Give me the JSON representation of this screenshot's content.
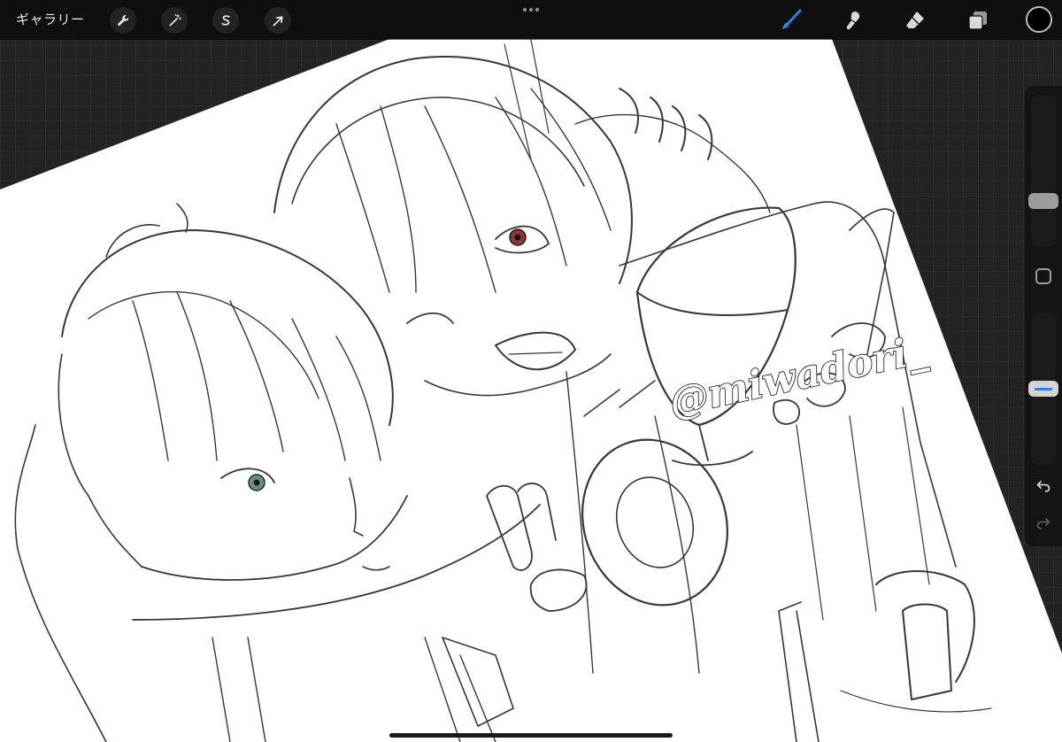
{
  "toolbar": {
    "gallery_label": "ギャラリー",
    "left_actions": [
      {
        "name": "wrench-icon",
        "label": "actions"
      },
      {
        "name": "magic-wand-icon",
        "label": "adjustments"
      },
      {
        "name": "selection-s-icon",
        "label": "selection"
      },
      {
        "name": "transform-arrow-icon",
        "label": "transform"
      }
    ],
    "right_tools": [
      {
        "name": "brush-icon",
        "active": true
      },
      {
        "name": "smudge-icon",
        "active": false
      },
      {
        "name": "eraser-icon",
        "active": false
      },
      {
        "name": "layers-icon",
        "active": false
      }
    ],
    "current_color": "#000000",
    "active_tool_color": "#2f7de6"
  },
  "sidebar": {
    "brush_size_level": 0.28,
    "brush_opacity_level": 0.5,
    "undo_icon": "undo-arrow-icon",
    "redo_icon": "redo-arrow-icon"
  },
  "canvas": {
    "watermark": "@miwadori_",
    "paper_color": "#ffffff",
    "line_color": "#3a3634",
    "eye_colors": {
      "left_character": "#6b8f7a",
      "right_character": "#8a3a2e"
    }
  }
}
